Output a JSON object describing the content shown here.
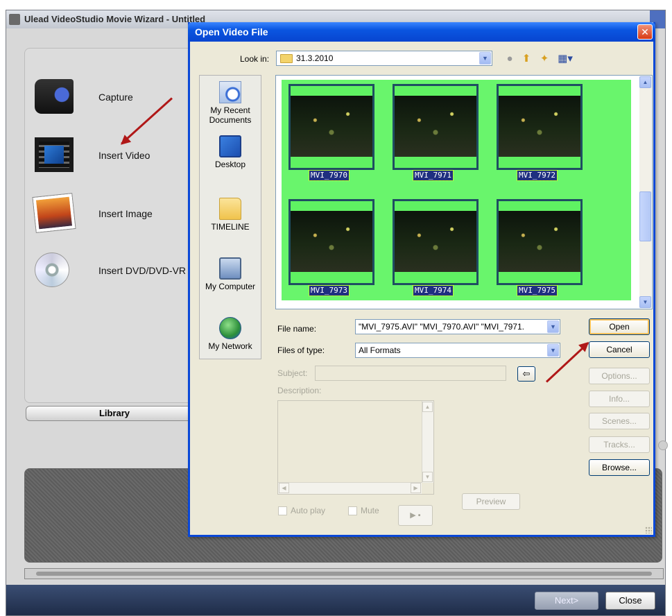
{
  "main_window": {
    "title": "Ulead VideoStudio Movie Wizard - Untitled",
    "actions": [
      {
        "label": "Capture",
        "icon": "camcorder-icon"
      },
      {
        "label": "Insert Video",
        "icon": "film-strip-icon"
      },
      {
        "label": "Insert Image",
        "icon": "picture-icon"
      },
      {
        "label": "Insert DVD/DVD-VR",
        "icon": "dvd-disc-icon"
      }
    ],
    "library_label": "Library",
    "next_label": "Next>",
    "close_label": "Close"
  },
  "dialog": {
    "title": "Open Video File",
    "look_in_label": "Look in:",
    "look_in_value": "31.3.2010",
    "places": [
      {
        "label": "My Recent Documents",
        "icon": "recent-documents-icon"
      },
      {
        "label": "Desktop",
        "icon": "desktop-icon"
      },
      {
        "label": "TIMELINE",
        "icon": "folder-icon"
      },
      {
        "label": "My Computer",
        "icon": "my-computer-icon"
      },
      {
        "label": "My Network",
        "icon": "my-network-icon"
      }
    ],
    "files": [
      "MVI_7970",
      "MVI_7971",
      "MVI_7972",
      "MVI_7973",
      "MVI_7974",
      "MVI_7975"
    ],
    "file_name_label": "File name:",
    "file_name_value": "\"MVI_7975.AVI\" \"MVI_7970.AVI\" \"MVI_7971.",
    "files_of_type_label": "Files of type:",
    "files_of_type_value": "All Formats",
    "subject_label": "Subject:",
    "description_label": "Description:",
    "auto_play_label": "Auto play",
    "mute_label": "Mute",
    "preview_label": "Preview",
    "buttons": {
      "open": "Open",
      "cancel": "Cancel",
      "options": "Options...",
      "info": "Info...",
      "scenes": "Scenes...",
      "tracks": "Tracks...",
      "browse": "Browse..."
    }
  },
  "colors": {
    "selection_green": "#69f56c",
    "annotation_red": "#b01818",
    "xp_title_blue": "#0a55e0"
  }
}
